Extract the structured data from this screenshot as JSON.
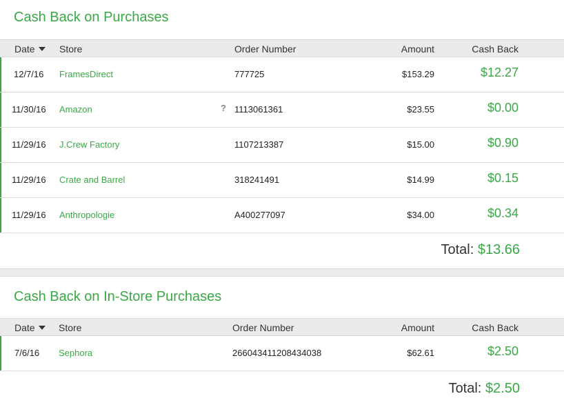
{
  "purchases": {
    "title": "Cash Back on Purchases",
    "headers": {
      "date": "Date",
      "store": "Store",
      "order": "Order Number",
      "amount": "Amount",
      "cashback": "Cash Back"
    },
    "rows": [
      {
        "date": "12/7/16",
        "store": "FramesDirect",
        "order": "777725",
        "amount": "$153.29",
        "cashback": "$12.27",
        "help": ""
      },
      {
        "date": "11/30/16",
        "store": "Amazon",
        "order": "1113061361",
        "amount": "$23.55",
        "cashback": "$0.00",
        "help": "?"
      },
      {
        "date": "11/29/16",
        "store": "J.Crew Factory",
        "order": "1107213387",
        "amount": "$15.00",
        "cashback": "$0.90",
        "help": ""
      },
      {
        "date": "11/29/16",
        "store": "Crate and Barrel",
        "order": "318241491",
        "amount": "$14.99",
        "cashback": "$0.15",
        "help": ""
      },
      {
        "date": "11/29/16",
        "store": "Anthropologie",
        "order": "A400277097",
        "amount": "$34.00",
        "cashback": "$0.34",
        "help": ""
      }
    ],
    "total_label": "Total:",
    "total_value": "$13.66"
  },
  "instore": {
    "title": "Cash Back on In-Store Purchases",
    "headers": {
      "date": "Date",
      "store": "Store",
      "order": "Order Number",
      "amount": "Amount",
      "cashback": "Cash Back"
    },
    "rows": [
      {
        "date": "7/6/16",
        "store": "Sephora",
        "order": "266043411208434038",
        "amount": "$62.61",
        "cashback": "$2.50"
      }
    ],
    "total_label": "Total:",
    "total_value": "$2.50"
  },
  "colors": {
    "accent": "#3aa845",
    "header_bg": "#ebebeb"
  },
  "icons": {
    "sort": "caret-down-icon",
    "help": "question-mark-icon"
  }
}
